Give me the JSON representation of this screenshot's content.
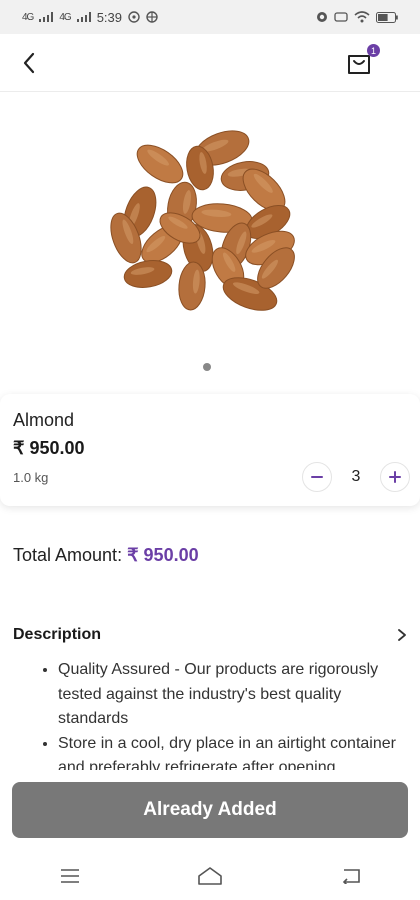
{
  "status_bar": {
    "network_left": "4G",
    "network_right": "4G",
    "time": "5:39",
    "battery_level": 0.6
  },
  "header": {
    "cart_badge_count": "1"
  },
  "product": {
    "image_alt": "Almonds",
    "name": "Almond",
    "price": "₹ 950.00",
    "weight": "1.0 kg",
    "quantity": "3",
    "carousel_pages": 1
  },
  "total": {
    "label": "Total Amount:",
    "amount": "₹ 950.00"
  },
  "description": {
    "title": "Description",
    "items": [
      "Quality Assured - Our products are rigorously tested against the industry's best quality standards",
      "Store in a cool, dry place in an airtight container and preferably refrigerate after opening"
    ]
  },
  "cta": {
    "label": "Already Added"
  },
  "colors": {
    "accent": "#6b3fa6",
    "button_disabled": "#787878"
  },
  "icons": [
    "back-arrow-icon",
    "cart-icon",
    "minus-icon",
    "plus-icon",
    "chevron-right-icon",
    "menu-icon",
    "home-icon",
    "back-icon"
  ]
}
